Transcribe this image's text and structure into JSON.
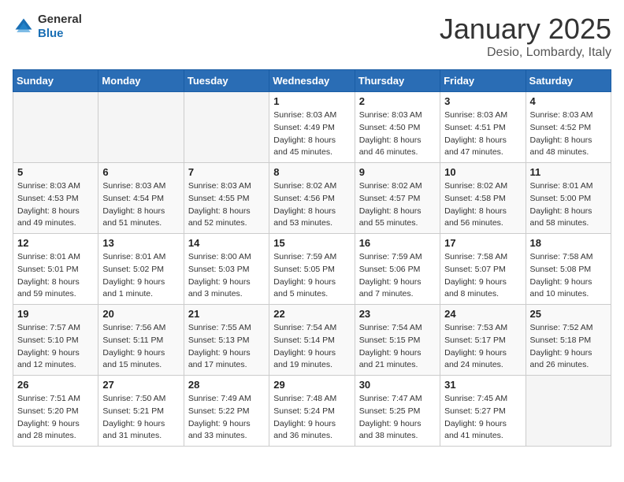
{
  "header": {
    "logo_general": "General",
    "logo_blue": "Blue",
    "title": "January 2025",
    "location": "Desio, Lombardy, Italy"
  },
  "weekdays": [
    "Sunday",
    "Monday",
    "Tuesday",
    "Wednesday",
    "Thursday",
    "Friday",
    "Saturday"
  ],
  "weeks": [
    [
      {
        "day": "",
        "info": ""
      },
      {
        "day": "",
        "info": ""
      },
      {
        "day": "",
        "info": ""
      },
      {
        "day": "1",
        "info": "Sunrise: 8:03 AM\nSunset: 4:49 PM\nDaylight: 8 hours\nand 45 minutes."
      },
      {
        "day": "2",
        "info": "Sunrise: 8:03 AM\nSunset: 4:50 PM\nDaylight: 8 hours\nand 46 minutes."
      },
      {
        "day": "3",
        "info": "Sunrise: 8:03 AM\nSunset: 4:51 PM\nDaylight: 8 hours\nand 47 minutes."
      },
      {
        "day": "4",
        "info": "Sunrise: 8:03 AM\nSunset: 4:52 PM\nDaylight: 8 hours\nand 48 minutes."
      }
    ],
    [
      {
        "day": "5",
        "info": "Sunrise: 8:03 AM\nSunset: 4:53 PM\nDaylight: 8 hours\nand 49 minutes."
      },
      {
        "day": "6",
        "info": "Sunrise: 8:03 AM\nSunset: 4:54 PM\nDaylight: 8 hours\nand 51 minutes."
      },
      {
        "day": "7",
        "info": "Sunrise: 8:03 AM\nSunset: 4:55 PM\nDaylight: 8 hours\nand 52 minutes."
      },
      {
        "day": "8",
        "info": "Sunrise: 8:02 AM\nSunset: 4:56 PM\nDaylight: 8 hours\nand 53 minutes."
      },
      {
        "day": "9",
        "info": "Sunrise: 8:02 AM\nSunset: 4:57 PM\nDaylight: 8 hours\nand 55 minutes."
      },
      {
        "day": "10",
        "info": "Sunrise: 8:02 AM\nSunset: 4:58 PM\nDaylight: 8 hours\nand 56 minutes."
      },
      {
        "day": "11",
        "info": "Sunrise: 8:01 AM\nSunset: 5:00 PM\nDaylight: 8 hours\nand 58 minutes."
      }
    ],
    [
      {
        "day": "12",
        "info": "Sunrise: 8:01 AM\nSunset: 5:01 PM\nDaylight: 8 hours\nand 59 minutes."
      },
      {
        "day": "13",
        "info": "Sunrise: 8:01 AM\nSunset: 5:02 PM\nDaylight: 9 hours\nand 1 minute."
      },
      {
        "day": "14",
        "info": "Sunrise: 8:00 AM\nSunset: 5:03 PM\nDaylight: 9 hours\nand 3 minutes."
      },
      {
        "day": "15",
        "info": "Sunrise: 7:59 AM\nSunset: 5:05 PM\nDaylight: 9 hours\nand 5 minutes."
      },
      {
        "day": "16",
        "info": "Sunrise: 7:59 AM\nSunset: 5:06 PM\nDaylight: 9 hours\nand 7 minutes."
      },
      {
        "day": "17",
        "info": "Sunrise: 7:58 AM\nSunset: 5:07 PM\nDaylight: 9 hours\nand 8 minutes."
      },
      {
        "day": "18",
        "info": "Sunrise: 7:58 AM\nSunset: 5:08 PM\nDaylight: 9 hours\nand 10 minutes."
      }
    ],
    [
      {
        "day": "19",
        "info": "Sunrise: 7:57 AM\nSunset: 5:10 PM\nDaylight: 9 hours\nand 12 minutes."
      },
      {
        "day": "20",
        "info": "Sunrise: 7:56 AM\nSunset: 5:11 PM\nDaylight: 9 hours\nand 15 minutes."
      },
      {
        "day": "21",
        "info": "Sunrise: 7:55 AM\nSunset: 5:13 PM\nDaylight: 9 hours\nand 17 minutes."
      },
      {
        "day": "22",
        "info": "Sunrise: 7:54 AM\nSunset: 5:14 PM\nDaylight: 9 hours\nand 19 minutes."
      },
      {
        "day": "23",
        "info": "Sunrise: 7:54 AM\nSunset: 5:15 PM\nDaylight: 9 hours\nand 21 minutes."
      },
      {
        "day": "24",
        "info": "Sunrise: 7:53 AM\nSunset: 5:17 PM\nDaylight: 9 hours\nand 24 minutes."
      },
      {
        "day": "25",
        "info": "Sunrise: 7:52 AM\nSunset: 5:18 PM\nDaylight: 9 hours\nand 26 minutes."
      }
    ],
    [
      {
        "day": "26",
        "info": "Sunrise: 7:51 AM\nSunset: 5:20 PM\nDaylight: 9 hours\nand 28 minutes."
      },
      {
        "day": "27",
        "info": "Sunrise: 7:50 AM\nSunset: 5:21 PM\nDaylight: 9 hours\nand 31 minutes."
      },
      {
        "day": "28",
        "info": "Sunrise: 7:49 AM\nSunset: 5:22 PM\nDaylight: 9 hours\nand 33 minutes."
      },
      {
        "day": "29",
        "info": "Sunrise: 7:48 AM\nSunset: 5:24 PM\nDaylight: 9 hours\nand 36 minutes."
      },
      {
        "day": "30",
        "info": "Sunrise: 7:47 AM\nSunset: 5:25 PM\nDaylight: 9 hours\nand 38 minutes."
      },
      {
        "day": "31",
        "info": "Sunrise: 7:45 AM\nSunset: 5:27 PM\nDaylight: 9 hours\nand 41 minutes."
      },
      {
        "day": "",
        "info": ""
      }
    ]
  ]
}
